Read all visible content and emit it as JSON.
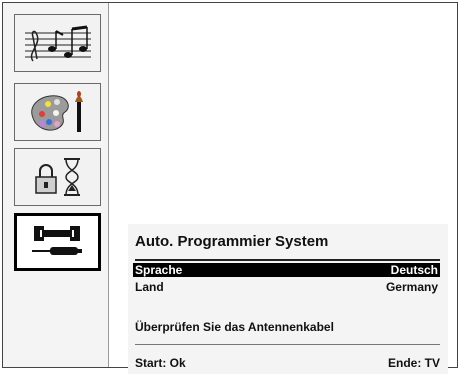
{
  "sidebar": {
    "items": [
      {
        "icon": "music-notes-icon"
      },
      {
        "icon": "paint-palette-icon"
      },
      {
        "icon": "lock-hourglass-icon"
      },
      {
        "icon": "wrench-screwdriver-icon",
        "selected": true
      }
    ]
  },
  "dialog": {
    "title": "Auto. Programmier System",
    "rows": [
      {
        "label": "Sprache",
        "value": "Deutsch",
        "selected": true
      },
      {
        "label": "Land",
        "value": "Germany",
        "selected": false
      }
    ],
    "notice": "Überprüfen Sie das Antennenkabel",
    "footer": {
      "start": "Start: Ok",
      "end": "Ende: TV"
    }
  },
  "colors": {
    "highlight": "#000000",
    "panel": "#f4f4f4"
  }
}
